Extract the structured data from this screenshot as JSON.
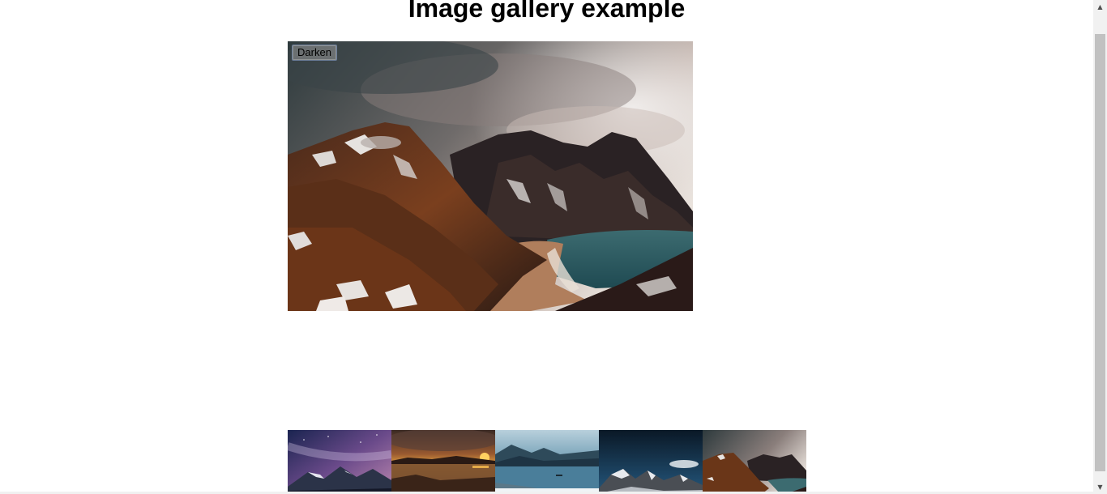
{
  "page": {
    "title": "Image gallery example"
  },
  "viewer": {
    "darken_label": "Darken",
    "selected_image": "mountains-lake-beach"
  },
  "thumbnails": [
    {
      "name": "thumb-milky-way-mountains"
    },
    {
      "name": "thumb-sunset-lake"
    },
    {
      "name": "thumb-misty-lake-boat"
    },
    {
      "name": "thumb-snowy-peaks"
    },
    {
      "name": "thumb-mountains-lake-beach"
    }
  ],
  "scrollbar": {
    "up_icon": "▲",
    "down_icon": "▼"
  }
}
